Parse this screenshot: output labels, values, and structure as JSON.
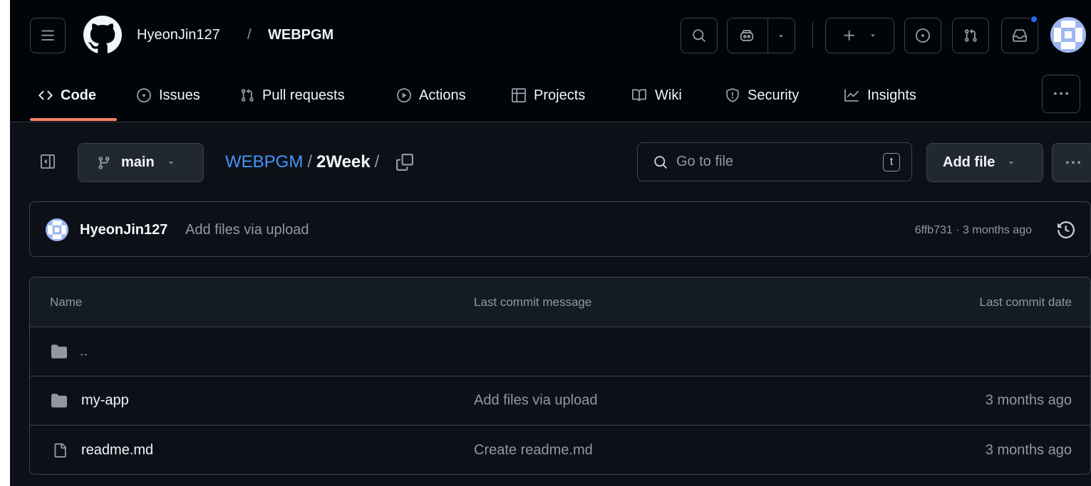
{
  "header": {
    "owner": "HyeonJin127",
    "separator": "/",
    "repo": "WEBPGM"
  },
  "tabs": [
    {
      "label": "Code",
      "icon": "code-icon",
      "selected": true
    },
    {
      "label": "Issues",
      "icon": "issue-opened-icon"
    },
    {
      "label": "Pull requests",
      "icon": "git-pull-request-icon"
    },
    {
      "label": "Actions",
      "icon": "play-icon"
    },
    {
      "label": "Projects",
      "icon": "table-icon"
    },
    {
      "label": "Wiki",
      "icon": "book-icon"
    },
    {
      "label": "Security",
      "icon": "shield-icon"
    },
    {
      "label": "Insights",
      "icon": "graph-icon"
    }
  ],
  "toolbar": {
    "branch": "main",
    "breadcrumb": {
      "repo": "WEBPGM",
      "folder": "2Week",
      "sep": "/"
    },
    "search_placeholder": "Go to file",
    "search_shortcut": "t",
    "add_file_label": "Add file"
  },
  "commit": {
    "author": "HyeonJin127",
    "message": "Add files via upload",
    "meta": "6ffb731 · 3 months ago"
  },
  "table": {
    "headers": {
      "name": "Name",
      "message": "Last commit message",
      "date": "Last commit date"
    },
    "parent_label": "..",
    "rows": [
      {
        "type": "folder",
        "name": "my-app",
        "message": "Add files via upload",
        "date": "3 months ago"
      },
      {
        "type": "file",
        "name": "readme.md",
        "message": "Create readme.md",
        "date": "3 months ago"
      }
    ]
  },
  "colors": {
    "background": "#0d1117",
    "header_background": "#010409",
    "link": "#4493f8",
    "tab_underline": "#f78166",
    "notification_dot": "#1f6feb"
  }
}
